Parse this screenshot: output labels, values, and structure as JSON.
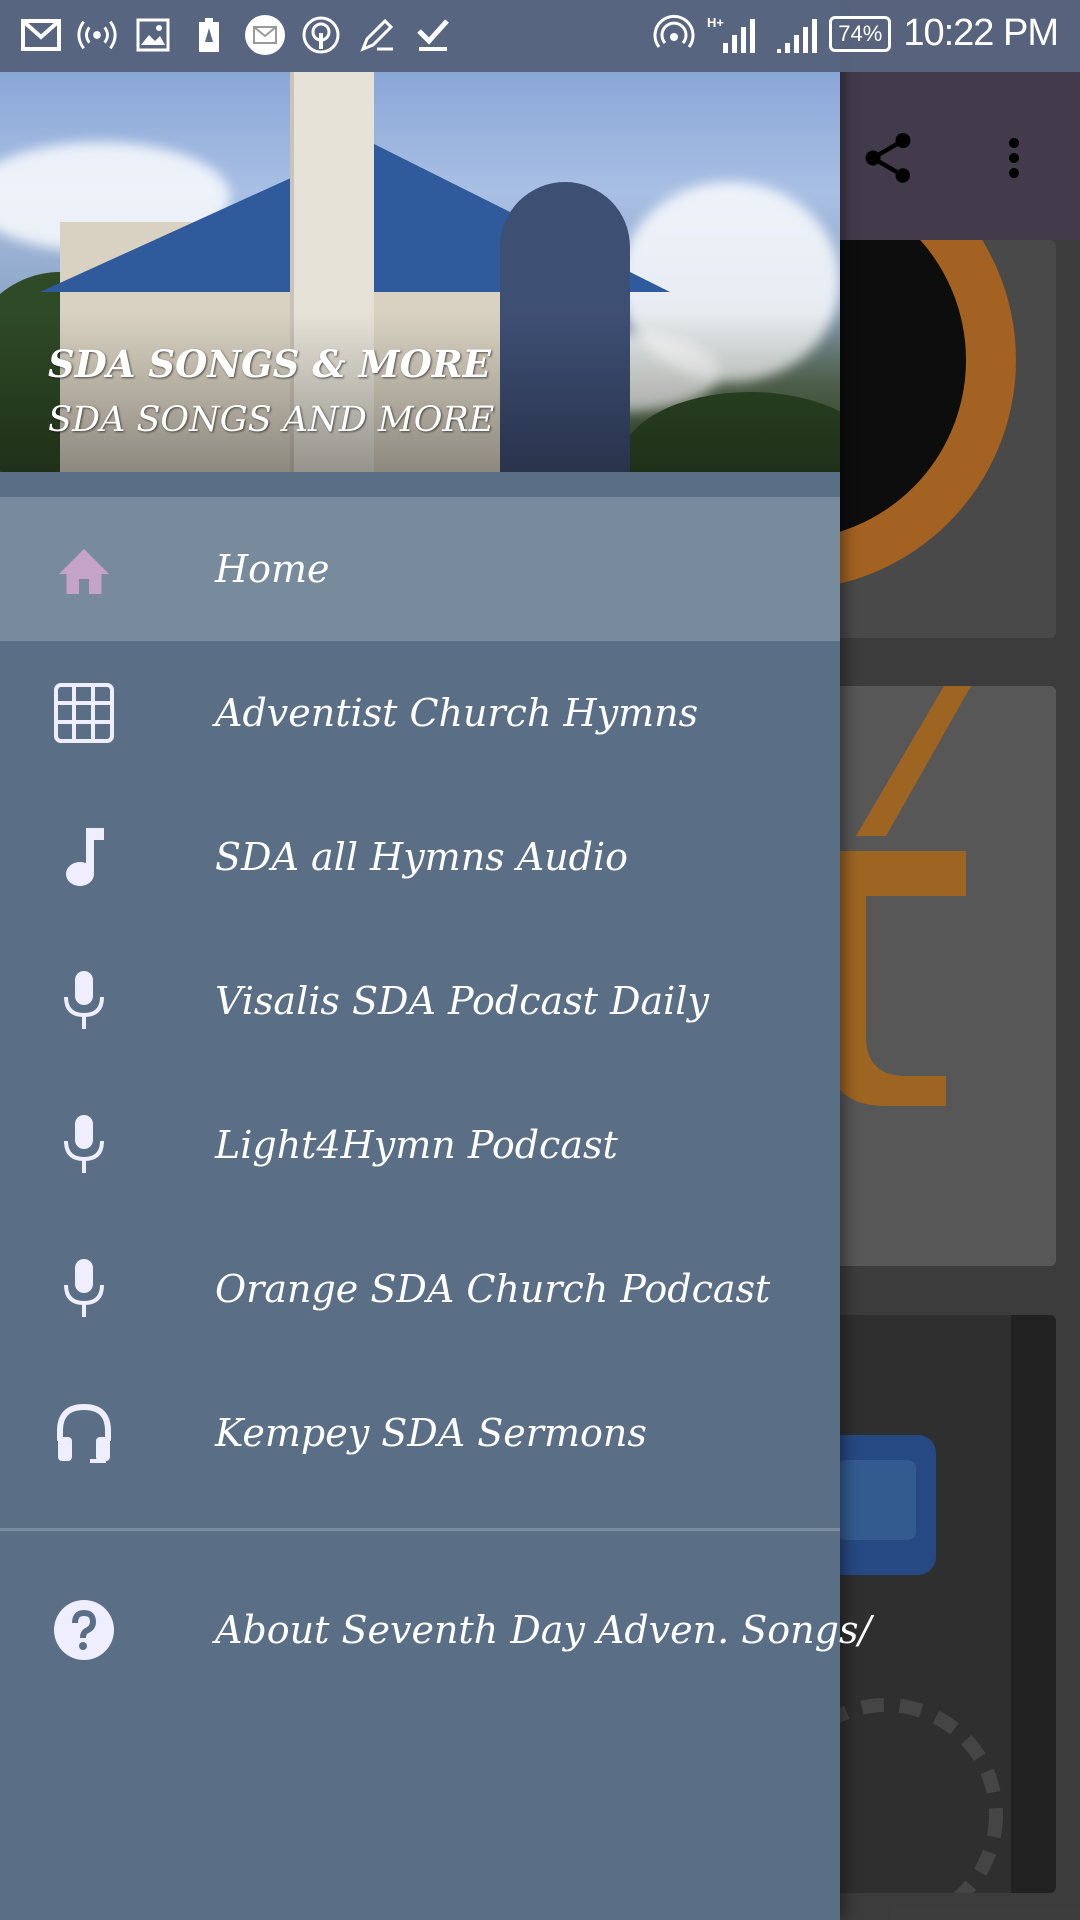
{
  "status_bar": {
    "battery": "74%",
    "time": "10:22 PM",
    "left_icons": [
      "gmail-icon",
      "hotspot-icon",
      "gallery-icon",
      "battery-saver-icon",
      "mail-icon",
      "podcast-icon",
      "edit-icon",
      "download-done-icon"
    ],
    "right_icons": [
      "wireless-icon",
      "signal-icon",
      "signal-icon-2"
    ]
  },
  "toolbar": {
    "icons": [
      "share-icon",
      "more-vert-icon"
    ]
  },
  "drawer": {
    "title": "SDA SONGS & MORE",
    "subtitle": "SDA SONGS AND MORE",
    "items": [
      {
        "label": "Home",
        "icon": "home-icon",
        "active": true
      },
      {
        "label": "Adventist Church Hymns",
        "icon": "grid-icon"
      },
      {
        "label": "SDA  all Hymns Audio",
        "icon": "music-note-icon"
      },
      {
        "label": "Visalis SDA Podcast Daily",
        "icon": "mic-icon"
      },
      {
        "label": "Light4Hymn Podcast",
        "icon": "mic-icon"
      },
      {
        "label": "Orange SDA Church Podcast",
        "icon": "mic-icon"
      },
      {
        "label": "Kempey SDA Sermons",
        "icon": "headphones-icon"
      }
    ],
    "about": {
      "label": "About Seventh Day Adven. Songs/",
      "icon": "help-icon"
    }
  },
  "colors": {
    "drawer_bg": "#5a6f86",
    "active_item_bg": "#788b9d",
    "home_icon": "#c5a3c6",
    "toolbar_bg": "#52495c"
  }
}
